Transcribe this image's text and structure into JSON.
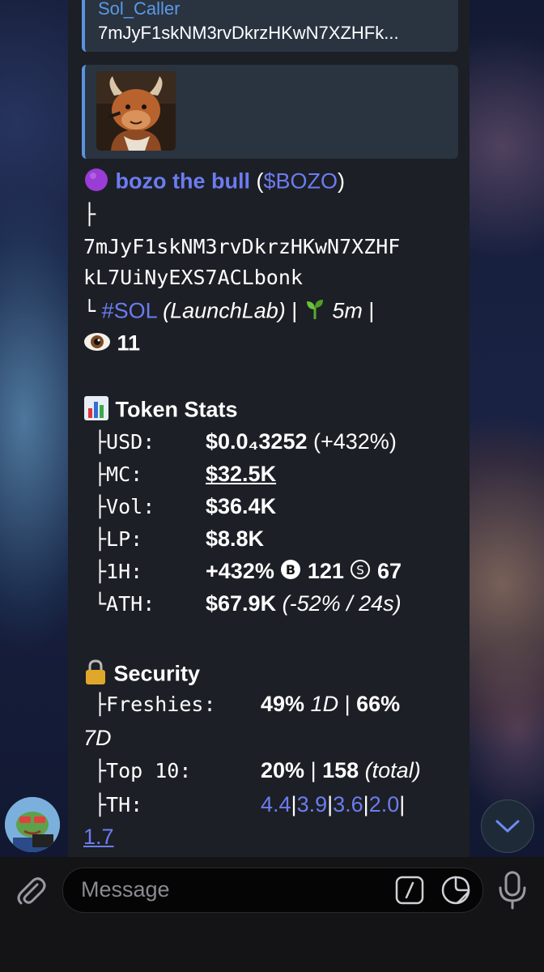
{
  "quotes": {
    "author": "Sol_Caller",
    "text": "7mJyF1skNM3rvDkrzHKwN7XZHFk..."
  },
  "token": {
    "status_icon": "purple-circle",
    "name": "bozo the bull",
    "ticker_open": "(",
    "ticker": "$BOZO",
    "ticker_close": ")",
    "tree_branch": "├",
    "address_line1": "7mJyF1skNM3rvDkrzHKwN7XZHF",
    "address_line2": "kL7UiNyEXS7ACLbonk",
    "tree_end": "└",
    "chain": "#SOL",
    "platform": "(LaunchLab)",
    "sep": "|",
    "age": "5m",
    "views": "11"
  },
  "stats": {
    "heading": "Token Stats",
    "rows": [
      {
        "label": "├USD:",
        "value": "$0.0₄3252",
        "extra": "(+432%)"
      },
      {
        "label": "├MC:",
        "value": "$32.5K"
      },
      {
        "label": "├Vol:",
        "value": "$36.4K"
      },
      {
        "label": "├LP:",
        "value": "$8.8K"
      },
      {
        "label": "├1H:",
        "value": "+432%",
        "buys": "121",
        "sells": "67"
      },
      {
        "label": "└ATH:",
        "value": "$67.9K",
        "extra": "(-52% / 24s)"
      }
    ]
  },
  "security": {
    "heading": "Security",
    "freshies_label": "├Freshies:",
    "freshies_1d": "49%",
    "freshies_1d_unit": "1D",
    "freshies_7d": "66%",
    "freshies_7d_unit": "7D",
    "top10_label": "├Top 10:",
    "top10_value": "20%",
    "top10_count": "158",
    "top10_total": "(total)",
    "th_label": "├TH:",
    "th_values": [
      "4.4",
      "3.9",
      "3.6",
      "2.0",
      "1.7"
    ]
  },
  "composer": {
    "placeholder": "Message"
  },
  "colors": {
    "link": "#6c7cf0",
    "quote_author": "#5a9ae6",
    "bubble": "#1c1f25"
  }
}
